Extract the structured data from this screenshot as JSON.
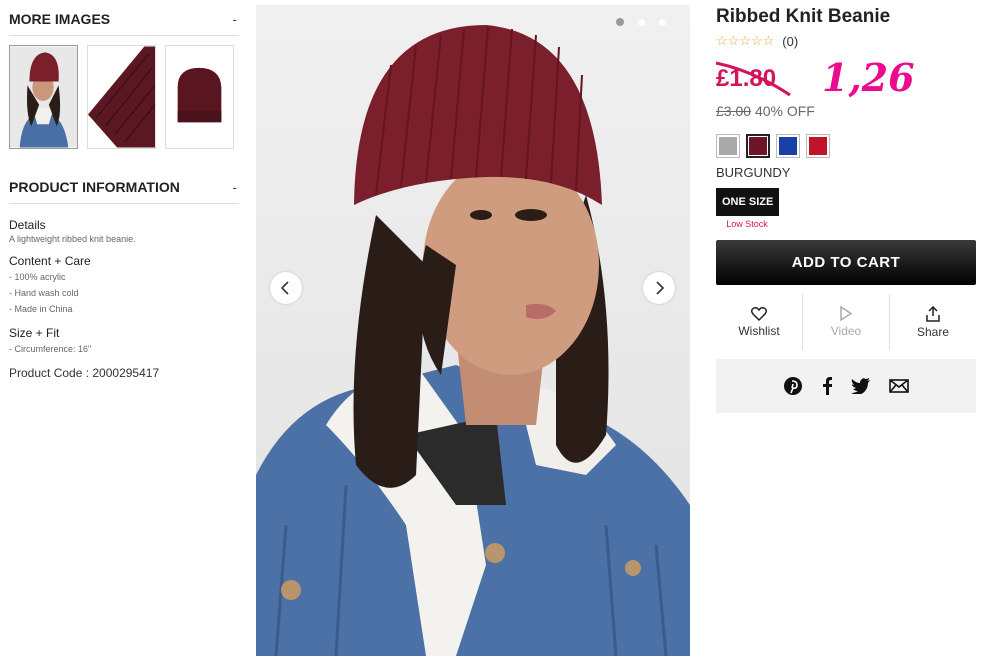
{
  "more_images": {
    "title": "MORE IMAGES",
    "toggle": "-"
  },
  "product_info": {
    "title": "PRODUCT INFORMATION",
    "toggle": "-",
    "details_heading": "Details",
    "details_text": "A lightweight ribbed knit beanie.",
    "content_heading": "Content + Care",
    "content_items": [
      "- 100% acrylic",
      "- Hand wash cold",
      "- Made in China"
    ],
    "size_heading": "Size + Fit",
    "size_items": [
      "- Circumference: 16\""
    ],
    "product_code": "Product Code : 2000295417"
  },
  "product": {
    "title": "Ribbed Knit Beanie",
    "rating_count": "(0)",
    "stars": "☆☆☆☆☆",
    "old_price": "£1.80",
    "new_price": "1,26",
    "original_price": "£3.00",
    "discount": "40% OFF",
    "color_name": "BURGUNDY",
    "size": "ONE SIZE",
    "stock": "Low Stock",
    "add_to_cart": "ADD TO CART",
    "wishlist": "Wishlist",
    "video": "Video",
    "share": "Share"
  },
  "swatches": [
    {
      "name": "heather-grey",
      "color": "#a9a9a9"
    },
    {
      "name": "burgundy",
      "color": "#6d1626"
    },
    {
      "name": "royal-blue",
      "color": "#1a3fa8"
    },
    {
      "name": "red",
      "color": "#c0142a"
    }
  ],
  "colors": {
    "accent": "#d4145a",
    "new_price": "#ec0a8d",
    "beanie": "#7a1f2b"
  },
  "carousel": {
    "active_dot": 1,
    "total_dots": 3
  }
}
